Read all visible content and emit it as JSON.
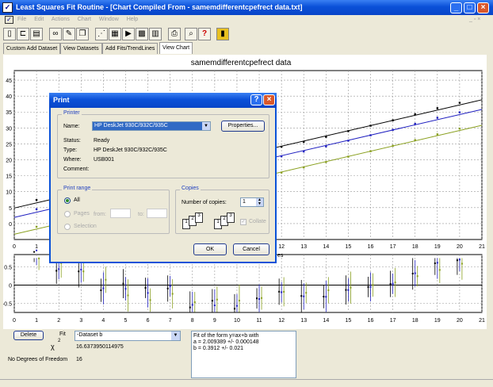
{
  "app": {
    "title": "Least Squares Fit Routine - [Chart Compiled From - samemdifferentcpefrect data.txt]"
  },
  "menu": [
    "File",
    "Edit",
    "Actions",
    "Chart",
    "Window",
    "Help"
  ],
  "toolbar": {
    "icons": [
      "new-icon",
      "open-icon",
      "save-icon",
      "binoculars-icon",
      "edit-data-icon",
      "copy-icon",
      "fit-icon",
      "chart-icon",
      "export-icon",
      "table-icon",
      "grid-icon",
      "print-icon",
      "print-preview-icon",
      "help-icon",
      "exit-icon"
    ]
  },
  "tabs": [
    "Custom Add Dataset",
    "View Datasets",
    "Add Fits/TrendLines",
    "View Chart"
  ],
  "chart": {
    "title": "samemdifferentcpefrect data",
    "xlabel_partial": "es",
    "xticks": [
      "0",
      "1",
      "2",
      "3",
      "4",
      "5",
      "6",
      "7",
      "8",
      "9",
      "10",
      "11",
      "12",
      "13",
      "14",
      "15",
      "16",
      "17",
      "18",
      "19",
      "20",
      "21"
    ],
    "yticks_main": [
      "45",
      "40",
      "35",
      "30",
      "25",
      "20",
      "15",
      "10",
      "5",
      "0"
    ],
    "yticks_resid": [
      "0.5",
      "0",
      "-0.5"
    ]
  },
  "chart_data": {
    "type": "scatter",
    "x": [
      1,
      2,
      3,
      4,
      5,
      6,
      7,
      8,
      9,
      10,
      11,
      12,
      13,
      14,
      15,
      16,
      17,
      18,
      19,
      20
    ],
    "series": [
      {
        "values": [
          7.4,
          8.5,
          10.1,
          11.2,
          13.0,
          14.5,
          16.1,
          17.2,
          19.0,
          20.4,
          22.3,
          24.1,
          25.6,
          27.2,
          29.0,
          30.7,
          32.4,
          34.3,
          36.2,
          37.9
        ],
        "color": "#000000"
      },
      {
        "values": [
          4.5,
          5.6,
          7.2,
          8.3,
          9.9,
          11.4,
          13.2,
          14.3,
          15.9,
          17.5,
          19.3,
          21.1,
          22.6,
          24.2,
          26.0,
          27.7,
          29.4,
          31.3,
          33.2,
          34.9
        ],
        "color": "#2020c0"
      },
      {
        "values": [
          -1.0,
          0.5,
          1.9,
          3.3,
          4.5,
          6.0,
          7.8,
          9.2,
          10.9,
          12.5,
          14.2,
          16.0,
          17.6,
          19.3,
          21.0,
          22.7,
          24.4,
          26.2,
          28.0,
          29.8
        ],
        "color": "#8aa020"
      }
    ],
    "xlim": [
      0,
      21
    ],
    "ylim": [
      -5,
      48
    ]
  },
  "bottom": {
    "delete_label": "Delete",
    "fit_label": "Fit",
    "chi_label": "χ",
    "chi_sup": "2",
    "dataset_selected": "-Dataset b",
    "chi_value": "16.6373950114975",
    "dof_label": "No Degrees of Freedom",
    "dof_value": "16",
    "fit_lines": [
      "Fit of the form y=ax+b with",
      "a = 2.009389 +/- 0.000148",
      "b = 0.3912 +/- 0.021"
    ]
  },
  "dialog": {
    "title": "Print",
    "printer_group": "Printer",
    "name_label": "Name:",
    "name_value": "HP DeskJet 930C/932C/935C",
    "properties_label": "Properties...",
    "status_label": "Status:",
    "status_value": "Ready",
    "type_label": "Type:",
    "type_value": "HP DeskJet 930C/932C/935C",
    "where_label": "Where:",
    "where_value": "USB001",
    "comment_label": "Comment:",
    "range_group": "Print range",
    "all_label": "All",
    "pages_label": "Pages",
    "from_label": "from:",
    "to_label": "to:",
    "selection_label": "Selection",
    "copies_group": "Copies",
    "copies_label": "Number of copies:",
    "copies_value": "1",
    "collate_label": "Collate",
    "ok_label": "OK",
    "cancel_label": "Cancel"
  }
}
